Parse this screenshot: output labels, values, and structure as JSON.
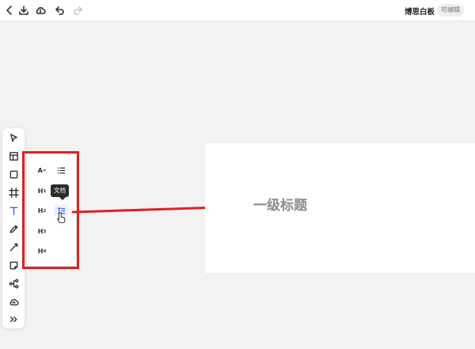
{
  "header": {
    "icons": [
      "back-icon",
      "download-icon",
      "cloud-save-icon",
      "undo-icon",
      "redo-icon"
    ],
    "title": "博思白板",
    "edit_badge": "可编辑"
  },
  "toolbar": {
    "tools": [
      "select-icon",
      "layout-icon",
      "rectangle-icon",
      "frame-icon",
      "text-icon",
      "pen-icon",
      "line-icon",
      "sticky-note-icon",
      "mindmap-icon",
      "upload-icon",
      "more-icon"
    ],
    "active_tool": "text-icon"
  },
  "text_panel": {
    "items": [
      {
        "main": "A",
        "sub": "="
      },
      {
        "main": "H",
        "sub": "1"
      },
      {
        "main": "H",
        "sub": "2"
      },
      {
        "main": "H",
        "sub": "3"
      },
      {
        "main": "H",
        "sub": "4"
      }
    ],
    "list_icon": "list-icon",
    "doc_icon": "document-icon"
  },
  "tooltip": "文档",
  "canvas": {
    "heading": "一级标题"
  },
  "colors": {
    "annotation": "#e02020",
    "accent": "#3b63e0"
  }
}
